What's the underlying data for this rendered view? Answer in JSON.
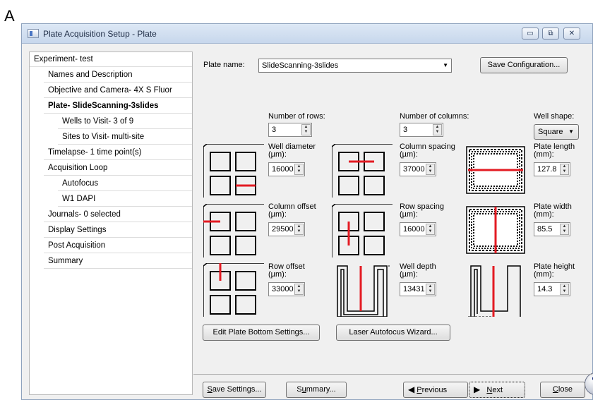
{
  "panel_letter": "A",
  "window": {
    "title": "Plate Acquisition Setup - Plate"
  },
  "caption_buttons": {
    "minimize": "▭",
    "maximize": "⧉",
    "close": "✕"
  },
  "nav": {
    "items": [
      {
        "label": "Experiment- test",
        "selected": false
      },
      {
        "label": "Names and Description",
        "selected": false
      },
      {
        "label": "Objective and Camera- 4X S Fluor",
        "selected": false
      },
      {
        "label": "Plate- SlideScanning-3slides",
        "selected": true
      },
      {
        "label": "Wells to Visit- 3 of 9",
        "selected": false
      },
      {
        "label": "Sites to Visit- multi-site",
        "selected": false
      },
      {
        "label": "Timelapse- 1 time point(s)",
        "selected": false
      },
      {
        "label": "Acquisition Loop",
        "selected": false
      },
      {
        "label": "Autofocus",
        "selected": false
      },
      {
        "label": "W1 DAPI",
        "selected": false
      },
      {
        "label": "Journals- 0 selected",
        "selected": false
      },
      {
        "label": "Display Settings",
        "selected": false
      },
      {
        "label": "Post Acquisition",
        "selected": false
      },
      {
        "label": "Summary",
        "selected": false
      }
    ]
  },
  "plate": {
    "name_label": "Plate name:",
    "name_value": "SlideScanning-3slides",
    "save_config_label": "Save Configuration...",
    "rows_label": "Number of rows:",
    "rows_value": "3",
    "columns_label": "Number of columns:",
    "columns_value": "3",
    "well_shape_label": "Well shape:",
    "well_shape_value": "Square",
    "well_diameter": {
      "label": "Well diameter (µm):",
      "value": "16000"
    },
    "column_spacing": {
      "label": "Column spacing (µm):",
      "value": "37000"
    },
    "plate_length": {
      "label": "Plate length (mm):",
      "value": "127.8"
    },
    "column_offset": {
      "label": "Column offset (µm):",
      "value": "29500"
    },
    "row_spacing": {
      "label": "Row spacing (µm):",
      "value": "16000"
    },
    "plate_width": {
      "label": "Plate width (mm):",
      "value": "85.5"
    },
    "row_offset": {
      "label": "Row offset (µm):",
      "value": "33000"
    },
    "well_depth": {
      "label": "Well depth (µm):",
      "value": "13431"
    },
    "plate_height": {
      "label": "Plate height (mm):",
      "value": "14.3"
    },
    "edit_bottom_label": "Edit Plate Bottom Settings...",
    "laser_af_label": "Laser Autofocus Wizard..."
  },
  "footer": {
    "save_settings": {
      "underlined": "S",
      "rest": "ave Settings..."
    },
    "summary": {
      "prefix": "S",
      "underlined": "u",
      "rest": "mmary..."
    },
    "previous": {
      "underlined": "P",
      "rest": "revious"
    },
    "next": {
      "underlined": "N",
      "rest": "ext"
    },
    "close": {
      "underlined": "C",
      "rest": "lose"
    }
  },
  "colors": {
    "accent_red": "#e31b23",
    "title_bar": "#c7d7ec"
  }
}
